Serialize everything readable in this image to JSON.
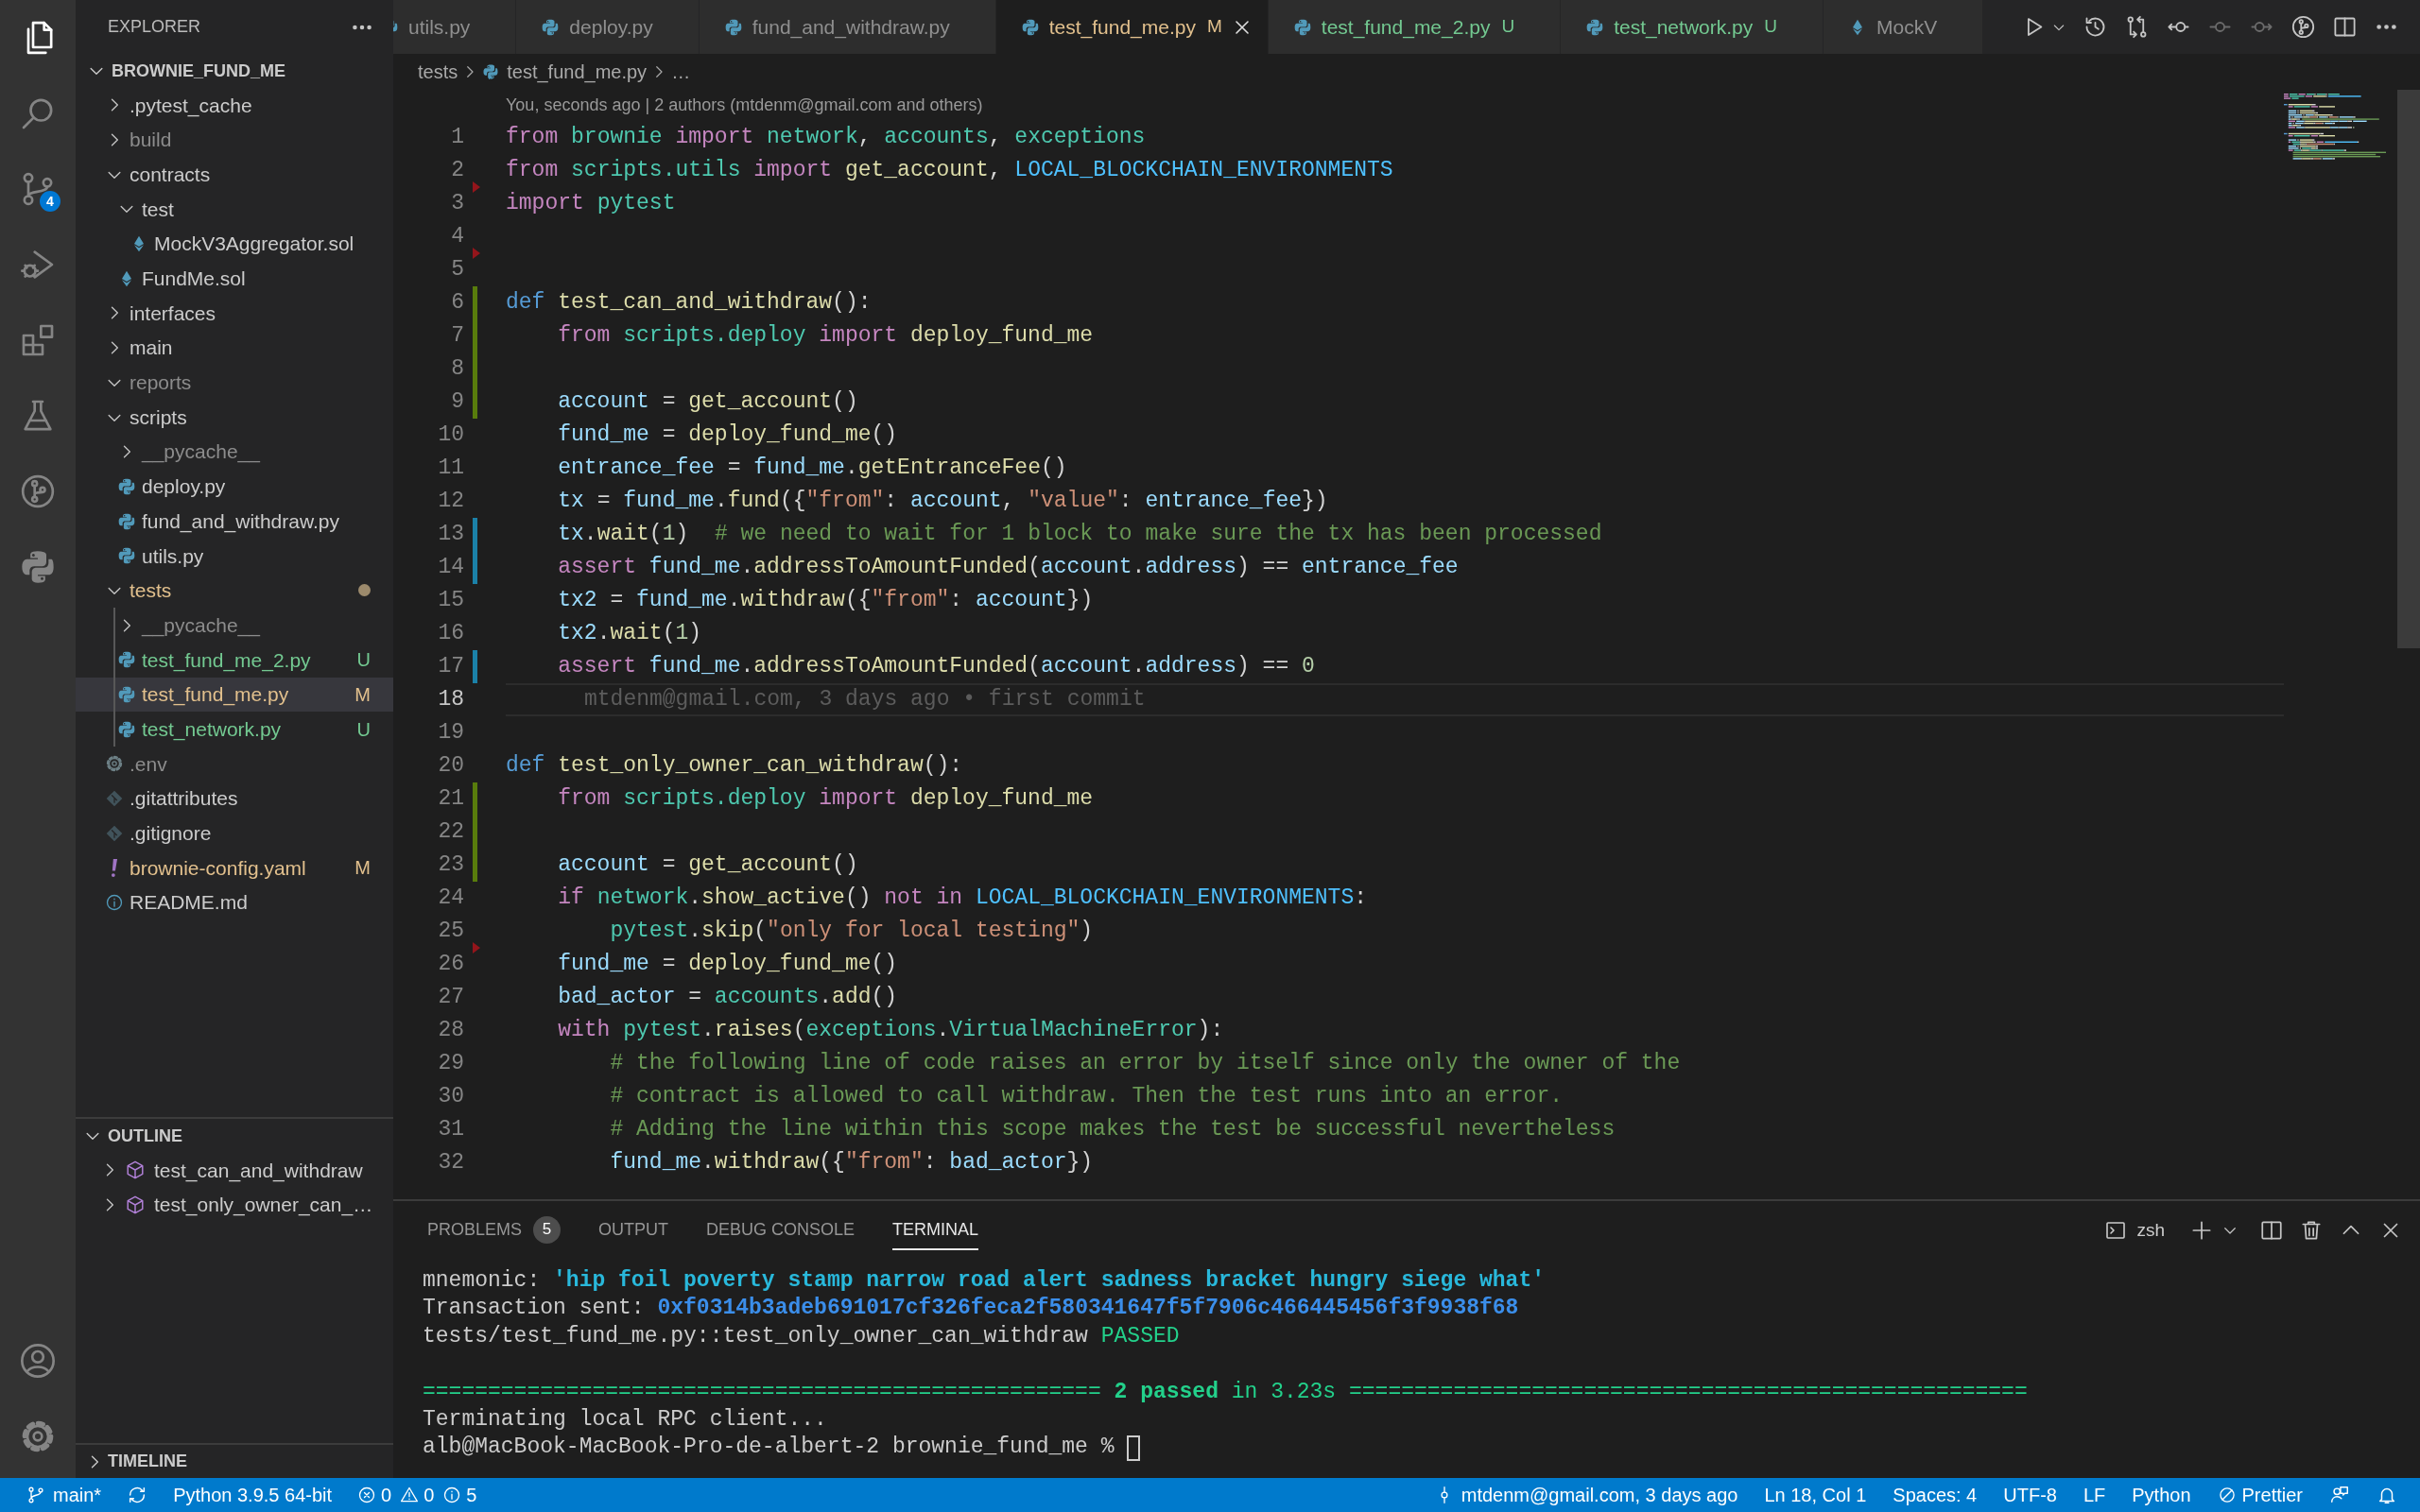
{
  "activity_bar": {
    "items": [
      {
        "kind": "files",
        "selected": true
      },
      {
        "kind": "search",
        "selected": false
      },
      {
        "kind": "source_control",
        "selected": false,
        "badge": "4"
      },
      {
        "kind": "run_debug",
        "selected": false
      },
      {
        "kind": "extensions",
        "selected": false
      },
      {
        "kind": "testing",
        "selected": false
      },
      {
        "kind": "git_graph",
        "selected": false
      },
      {
        "kind": "python",
        "selected": false
      }
    ],
    "bottom": [
      {
        "kind": "account"
      },
      {
        "kind": "settings"
      }
    ]
  },
  "sidebar": {
    "title": "EXPLORER",
    "folder": {
      "label": "BROWNIE_FUND_ME",
      "expanded": true,
      "items": [
        {
          "label": ".pytest_cache",
          "kind": "folder",
          "expanded": false,
          "dot": false,
          "color": "#cccccc",
          "selected": false
        },
        {
          "label": "build",
          "kind": "folder",
          "expanded": false,
          "dot": false,
          "color": "#8c8c8c",
          "selected": false
        },
        {
          "label": "contracts",
          "kind": "folder",
          "expanded": true,
          "dot": false,
          "color": "#cccccc",
          "selected": false,
          "children": [
            {
              "label": "test",
              "kind": "folder",
              "expanded": true,
              "dot": false,
              "color": "#cccccc",
              "selected": false,
              "children": [
                {
                  "label": "MockV3Aggregator.sol",
                  "kind": "solidity",
                  "color": "#cccccc",
                  "selected": false
                }
              ]
            },
            {
              "label": "FundMe.sol",
              "kind": "solidity",
              "color": "#cccccc",
              "selected": false
            }
          ]
        },
        {
          "label": "interfaces",
          "kind": "folder",
          "expanded": false,
          "dot": false,
          "color": "#cccccc",
          "selected": false
        },
        {
          "label": "main",
          "kind": "folder",
          "expanded": false,
          "dot": false,
          "color": "#cccccc",
          "selected": false
        },
        {
          "label": "reports",
          "kind": "folder",
          "expanded": true,
          "dot": false,
          "color": "#8c8c8c",
          "selected": false
        },
        {
          "label": "scripts",
          "kind": "folder",
          "expanded": true,
          "dot": false,
          "color": "#cccccc",
          "selected": false,
          "children": [
            {
              "label": "__pycache__",
              "kind": "folder",
              "expanded": false,
              "dot": false,
              "color": "#8c8c8c",
              "selected": false
            },
            {
              "label": "deploy.py",
              "kind": "python",
              "color": "#cccccc",
              "selected": false
            },
            {
              "label": "fund_and_withdraw.py",
              "kind": "python",
              "color": "#cccccc",
              "selected": false
            },
            {
              "label": "utils.py",
              "kind": "python",
              "color": "#cccccc",
              "selected": false
            }
          ]
        },
        {
          "label": "tests",
          "kind": "folder",
          "expanded": true,
          "dot": true,
          "color": "#e2c08d",
          "selected": false,
          "children": [
            {
              "label": "__pycache__",
              "kind": "folder",
              "expanded": false,
              "dot": false,
              "color": "#8c8c8c",
              "selected": false
            },
            {
              "label": "test_fund_me_2.py",
              "kind": "python",
              "color": "#73c991",
              "badge": "U",
              "selected": false
            },
            {
              "label": "test_fund_me.py",
              "kind": "python",
              "color": "#e2c08d",
              "badge": "M",
              "selected": true
            },
            {
              "label": "test_network.py",
              "kind": "python",
              "color": "#73c991",
              "badge": "U",
              "selected": false
            }
          ]
        },
        {
          "label": ".env",
          "kind": "config",
          "color": "#8c8c8c",
          "selected": false
        },
        {
          "label": ".gitattributes",
          "kind": "git",
          "color": "#cccccc",
          "selected": false
        },
        {
          "label": ".gitignore",
          "kind": "git",
          "color": "#cccccc",
          "selected": false
        },
        {
          "label": "brownie-config.yaml",
          "kind": "yaml",
          "color": "#e2c08d",
          "badge": "M",
          "selected": false
        },
        {
          "label": "README.md",
          "kind": "info",
          "color": "#cccccc",
          "selected": false
        }
      ]
    },
    "outline": {
      "title": "OUTLINE",
      "expanded": true,
      "items": [
        {
          "label": "test_can_and_withdraw",
          "expanded": false
        },
        {
          "label": "test_only_owner_can_…",
          "expanded": false
        }
      ]
    },
    "timeline": {
      "title": "TIMELINE",
      "expanded": false
    }
  },
  "editor": {
    "tabs": [
      {
        "label": "utils.py",
        "kind": "python",
        "color": "#8f8f8f",
        "selected": false
      },
      {
        "label": "deploy.py",
        "kind": "python",
        "color": "#8f8f8f",
        "selected": false
      },
      {
        "label": "fund_and_withdraw.py",
        "kind": "python",
        "color": "#8f8f8f",
        "selected": false
      },
      {
        "label": "test_fund_me.py",
        "kind": "python",
        "color": "#e2c08d",
        "badge": "M",
        "selected": true
      },
      {
        "label": "test_fund_me_2.py",
        "kind": "python",
        "color": "#73c991",
        "badge": "U",
        "selected": false
      },
      {
        "label": "test_network.py",
        "kind": "python",
        "color": "#73c991",
        "badge": "U",
        "selected": false
      },
      {
        "label": "MockV",
        "kind": "solidity",
        "color": "#8f8f8f",
        "selected": false
      }
    ],
    "actions": [
      {
        "kind": "run",
        "disabled": false
      },
      {
        "kind": "history",
        "disabled": false
      },
      {
        "kind": "compare",
        "disabled": false
      },
      {
        "kind": "previous_change",
        "disabled": false
      },
      {
        "kind": "current_change",
        "disabled": true
      },
      {
        "kind": "next_change",
        "disabled": true
      },
      {
        "kind": "git_graph",
        "disabled": false
      },
      {
        "kind": "split",
        "disabled": false
      },
      {
        "kind": "more",
        "disabled": false
      }
    ],
    "breadcrumbs": [
      {
        "label": "tests",
        "kind": "folder"
      },
      {
        "label": "test_fund_me.py",
        "kind": "python"
      },
      {
        "label": "…",
        "kind": "more"
      }
    ],
    "codelens": "You, seconds ago | 2 authors (mtdenm@gmail.com and others)",
    "lines": [
      {
        "n": "1",
        "kind": "plain",
        "current": false,
        "tokens": [
          {
            "kind": "kw",
            "text": "from"
          },
          {
            "kind": "cls",
            "text": " brownie"
          },
          {
            "kind": "kw",
            "text": " import"
          },
          {
            "kind": "cls",
            "text": " network"
          },
          {
            "kind": "p",
            "text": ", "
          },
          {
            "kind": "cls",
            "text": "accounts"
          },
          {
            "kind": "p",
            "text": ", "
          },
          {
            "kind": "cls",
            "text": "exceptions"
          }
        ]
      },
      {
        "n": "2",
        "kind": "plain",
        "current": false,
        "tokens": [
          {
            "kind": "kw",
            "text": "from"
          },
          {
            "kind": "cls",
            "text": " scripts.utils"
          },
          {
            "kind": "kw",
            "text": " import"
          },
          {
            "kind": "fn",
            "text": " get_account"
          },
          {
            "kind": "p",
            "text": ", "
          },
          {
            "kind": "const",
            "text": "LOCAL_BLOCKCHAIN_ENVIRONMENTS"
          }
        ]
      },
      {
        "n": "3",
        "kind": "deleted",
        "current": false,
        "tokens": [
          {
            "kind": "kw",
            "text": "import"
          },
          {
            "kind": "cls",
            "text": " pytest"
          }
        ]
      },
      {
        "n": "4",
        "kind": "plain",
        "current": false
      },
      {
        "n": "5",
        "kind": "deleted",
        "current": false
      },
      {
        "n": "6",
        "kind": "added",
        "current": false,
        "tokens": [
          {
            "kind": "def",
            "text": "def"
          },
          {
            "kind": "fn",
            "text": " test_can_and_withdraw"
          },
          {
            "kind": "p",
            "text": "():"
          }
        ]
      },
      {
        "n": "7",
        "kind": "added",
        "current": false,
        "tokens": [
          {
            "kind": "kw",
            "text": "    from"
          },
          {
            "kind": "cls",
            "text": " scripts.deploy"
          },
          {
            "kind": "kw",
            "text": " import"
          },
          {
            "kind": "fn",
            "text": " deploy_fund_me"
          }
        ]
      },
      {
        "n": "8",
        "kind": "added",
        "current": false
      },
      {
        "n": "9",
        "kind": "added",
        "current": false,
        "tokens": [
          {
            "kind": "var",
            "text": "    account"
          },
          {
            "kind": "p",
            "text": " = "
          },
          {
            "kind": "fn",
            "text": "get_account"
          },
          {
            "kind": "p",
            "text": "()"
          }
        ]
      },
      {
        "n": "10",
        "kind": "plain",
        "current": false,
        "tokens": [
          {
            "kind": "var",
            "text": "    fund_me"
          },
          {
            "kind": "p",
            "text": " = "
          },
          {
            "kind": "fn",
            "text": "deploy_fund_me"
          },
          {
            "kind": "p",
            "text": "()"
          }
        ]
      },
      {
        "n": "11",
        "kind": "plain",
        "current": false,
        "tokens": [
          {
            "kind": "var",
            "text": "    entrance_fee"
          },
          {
            "kind": "p",
            "text": " = "
          },
          {
            "kind": "var",
            "text": "fund_me"
          },
          {
            "kind": "p",
            "text": "."
          },
          {
            "kind": "fn",
            "text": "getEntranceFee"
          },
          {
            "kind": "p",
            "text": "()"
          }
        ]
      },
      {
        "n": "12",
        "kind": "plain",
        "current": false,
        "tokens": [
          {
            "kind": "var",
            "text": "    tx"
          },
          {
            "kind": "p",
            "text": " = "
          },
          {
            "kind": "var",
            "text": "fund_me"
          },
          {
            "kind": "p",
            "text": "."
          },
          {
            "kind": "fn",
            "text": "fund"
          },
          {
            "kind": "p",
            "text": "({"
          },
          {
            "kind": "str",
            "text": "\"from\""
          },
          {
            "kind": "p",
            "text": ": "
          },
          {
            "kind": "var",
            "text": "account"
          },
          {
            "kind": "p",
            "text": ", "
          },
          {
            "kind": "str",
            "text": "\"value\""
          },
          {
            "kind": "p",
            "text": ": "
          },
          {
            "kind": "var",
            "text": "entrance_fee"
          },
          {
            "kind": "p",
            "text": "})"
          }
        ]
      },
      {
        "n": "13",
        "kind": "modified",
        "current": false,
        "tokens": [
          {
            "kind": "var",
            "text": "    tx"
          },
          {
            "kind": "p",
            "text": "."
          },
          {
            "kind": "fn",
            "text": "wait"
          },
          {
            "kind": "p",
            "text": "("
          },
          {
            "kind": "num",
            "text": "1"
          },
          {
            "kind": "p",
            "text": ")  "
          },
          {
            "kind": "com",
            "text": "# we need to wait for 1 block to make sure the tx has been processed"
          }
        ]
      },
      {
        "n": "14",
        "kind": "modified",
        "current": false,
        "tokens": [
          {
            "kind": "kw",
            "text": "    assert"
          },
          {
            "kind": "var",
            "text": " fund_me"
          },
          {
            "kind": "p",
            "text": "."
          },
          {
            "kind": "fn",
            "text": "addressToAmountFunded"
          },
          {
            "kind": "p",
            "text": "("
          },
          {
            "kind": "var",
            "text": "account"
          },
          {
            "kind": "p",
            "text": "."
          },
          {
            "kind": "var",
            "text": "address"
          },
          {
            "kind": "p",
            "text": ") == "
          },
          {
            "kind": "var",
            "text": "entrance_fee"
          }
        ]
      },
      {
        "n": "15",
        "kind": "plain",
        "current": false,
        "tokens": [
          {
            "kind": "var",
            "text": "    tx2"
          },
          {
            "kind": "p",
            "text": " = "
          },
          {
            "kind": "var",
            "text": "fund_me"
          },
          {
            "kind": "p",
            "text": "."
          },
          {
            "kind": "fn",
            "text": "withdraw"
          },
          {
            "kind": "p",
            "text": "({"
          },
          {
            "kind": "str",
            "text": "\"from\""
          },
          {
            "kind": "p",
            "text": ": "
          },
          {
            "kind": "var",
            "text": "account"
          },
          {
            "kind": "p",
            "text": "})"
          }
        ]
      },
      {
        "n": "16",
        "kind": "plain",
        "current": false,
        "tokens": [
          {
            "kind": "var",
            "text": "    tx2"
          },
          {
            "kind": "p",
            "text": "."
          },
          {
            "kind": "fn",
            "text": "wait"
          },
          {
            "kind": "p",
            "text": "("
          },
          {
            "kind": "num",
            "text": "1"
          },
          {
            "kind": "p",
            "text": ")"
          }
        ]
      },
      {
        "n": "17",
        "kind": "modified",
        "current": false,
        "tokens": [
          {
            "kind": "kw",
            "text": "    assert"
          },
          {
            "kind": "var",
            "text": " fund_me"
          },
          {
            "kind": "p",
            "text": "."
          },
          {
            "kind": "fn",
            "text": "addressToAmountFunded"
          },
          {
            "kind": "p",
            "text": "("
          },
          {
            "kind": "var",
            "text": "account"
          },
          {
            "kind": "p",
            "text": "."
          },
          {
            "kind": "var",
            "text": "address"
          },
          {
            "kind": "p",
            "text": ") == "
          },
          {
            "kind": "num",
            "text": "0"
          }
        ]
      },
      {
        "n": "18",
        "kind": "plain",
        "current": true,
        "blame": "mtdenm@gmail.com, 3 days ago • first commit"
      },
      {
        "n": "19",
        "kind": "plain",
        "current": false
      },
      {
        "n": "20",
        "kind": "plain",
        "current": false,
        "tokens": [
          {
            "kind": "def",
            "text": "def"
          },
          {
            "kind": "fn",
            "text": " test_only_owner_can_withdraw"
          },
          {
            "kind": "p",
            "text": "():"
          }
        ]
      },
      {
        "n": "21",
        "kind": "added",
        "current": false,
        "tokens": [
          {
            "kind": "kw",
            "text": "    from"
          },
          {
            "kind": "cls",
            "text": " scripts.deploy"
          },
          {
            "kind": "kw",
            "text": " import"
          },
          {
            "kind": "fn",
            "text": " deploy_fund_me"
          }
        ]
      },
      {
        "n": "22",
        "kind": "added",
        "current": false
      },
      {
        "n": "23",
        "kind": "added",
        "current": false,
        "tokens": [
          {
            "kind": "var",
            "text": "    account"
          },
          {
            "kind": "p",
            "text": " = "
          },
          {
            "kind": "fn",
            "text": "get_account"
          },
          {
            "kind": "p",
            "text": "()"
          }
        ]
      },
      {
        "n": "24",
        "kind": "plain",
        "current": false,
        "tokens": [
          {
            "kind": "kw",
            "text": "    if"
          },
          {
            "kind": "cls",
            "text": " network"
          },
          {
            "kind": "p",
            "text": "."
          },
          {
            "kind": "fn",
            "text": "show_active"
          },
          {
            "kind": "p",
            "text": "() "
          },
          {
            "kind": "kw",
            "text": "not in"
          },
          {
            "kind": "const",
            "text": " LOCAL_BLOCKCHAIN_ENVIRONMENTS"
          },
          {
            "kind": "p",
            "text": ":"
          }
        ]
      },
      {
        "n": "25",
        "kind": "plain",
        "current": false,
        "tokens": [
          {
            "kind": "cls",
            "text": "        pytest"
          },
          {
            "kind": "p",
            "text": "."
          },
          {
            "kind": "fn",
            "text": "skip"
          },
          {
            "kind": "p",
            "text": "("
          },
          {
            "kind": "str",
            "text": "\"only for local testing\""
          },
          {
            "kind": "p",
            "text": ")"
          }
        ]
      },
      {
        "n": "26",
        "kind": "deleted",
        "current": false,
        "tokens": [
          {
            "kind": "var",
            "text": "    fund_me"
          },
          {
            "kind": "p",
            "text": " = "
          },
          {
            "kind": "fn",
            "text": "deploy_fund_me"
          },
          {
            "kind": "p",
            "text": "()"
          }
        ]
      },
      {
        "n": "27",
        "kind": "plain",
        "current": false,
        "tokens": [
          {
            "kind": "var",
            "text": "    bad_actor"
          },
          {
            "kind": "p",
            "text": " = "
          },
          {
            "kind": "cls",
            "text": "accounts"
          },
          {
            "kind": "p",
            "text": "."
          },
          {
            "kind": "fn",
            "text": "add"
          },
          {
            "kind": "p",
            "text": "()"
          }
        ]
      },
      {
        "n": "28",
        "kind": "plain",
        "current": false,
        "tokens": [
          {
            "kind": "kw",
            "text": "    with"
          },
          {
            "kind": "cls",
            "text": " pytest"
          },
          {
            "kind": "p",
            "text": "."
          },
          {
            "kind": "fn",
            "text": "raises"
          },
          {
            "kind": "p",
            "text": "("
          },
          {
            "kind": "cls",
            "text": "exceptions"
          },
          {
            "kind": "p",
            "text": "."
          },
          {
            "kind": "cls",
            "text": "VirtualMachineError"
          },
          {
            "kind": "p",
            "text": "):"
          }
        ]
      },
      {
        "n": "29",
        "kind": "plain",
        "current": false,
        "tokens": [
          {
            "kind": "com",
            "text": "        # the following line of code raises an error by itself since only the owner of the"
          }
        ]
      },
      {
        "n": "30",
        "kind": "plain",
        "current": false,
        "tokens": [
          {
            "kind": "com",
            "text": "        # contract is allowed to call withdraw. Then the test runs into an error."
          }
        ]
      },
      {
        "n": "31",
        "kind": "plain",
        "current": false,
        "tokens": [
          {
            "kind": "com",
            "text": "        # Adding the line within this scope makes the test be successful nevertheless"
          }
        ]
      },
      {
        "n": "32",
        "kind": "plain",
        "current": false,
        "tokens": [
          {
            "kind": "var",
            "text": "        fund_me"
          },
          {
            "kind": "p",
            "text": "."
          },
          {
            "kind": "fn",
            "text": "withdraw"
          },
          {
            "kind": "p",
            "text": "({"
          },
          {
            "kind": "str",
            "text": "\"from\""
          },
          {
            "kind": "p",
            "text": ": "
          },
          {
            "kind": "var",
            "text": "bad_actor"
          },
          {
            "kind": "p",
            "text": "})"
          }
        ]
      }
    ]
  },
  "panel": {
    "tabs": [
      {
        "label": "PROBLEMS",
        "badge": "5",
        "selected": false
      },
      {
        "label": "OUTPUT",
        "selected": false
      },
      {
        "label": "DEBUG CONSOLE",
        "selected": false
      },
      {
        "label": "TERMINAL",
        "selected": true
      }
    ],
    "shell": "zsh",
    "terminal": [
      {
        "kind": "text",
        "segments": [
          {
            "kind": "p",
            "text": "mnemonic: "
          },
          {
            "kind": "cyan",
            "text": "'hip foil poverty stamp narrow road alert sadness bracket hungry siege what'"
          }
        ]
      },
      {
        "kind": "text",
        "segments": [
          {
            "kind": "p",
            "text": "Transaction sent: "
          },
          {
            "kind": "blue",
            "text": "0xf0314b3adeb691017cf326feca2f580341647f5f7906c466445456f3f9938f68"
          }
        ]
      },
      {
        "kind": "text",
        "segments": [
          {
            "kind": "p",
            "text": "tests/test_fund_me.py::test_only_owner_can_withdraw "
          },
          {
            "kind": "green",
            "text": "PASSED"
          }
        ]
      },
      {
        "kind": "blank"
      },
      {
        "kind": "text",
        "segments": [
          {
            "kind": "green",
            "text": "==================================================== "
          },
          {
            "kind": "greenb",
            "text": "2 passed"
          },
          {
            "kind": "green",
            "text": " in 3.23s ===================================================="
          }
        ]
      },
      {
        "kind": "text",
        "segments": [
          {
            "kind": "p",
            "text": "Terminating local RPC client..."
          }
        ]
      },
      {
        "kind": "prompt",
        "segments": [
          {
            "kind": "p",
            "text": "alb@MacBook-MacBook-Pro-de-albert-2 brownie_fund_me % "
          }
        ]
      }
    ]
  },
  "status_bar": {
    "left": [
      {
        "kind": "branch",
        "text": "main*"
      },
      {
        "kind": "sync"
      },
      {
        "kind": "text",
        "text": "Python 3.9.5 64-bit"
      },
      {
        "kind": "problems",
        "errors": "0",
        "warnings": "0",
        "infos": "5"
      }
    ],
    "right": [
      {
        "kind": "blame",
        "text": "mtdenm@gmail.com, 3 days ago"
      },
      {
        "kind": "text",
        "text": "Ln 18, Col 1"
      },
      {
        "kind": "text",
        "text": "Spaces: 4"
      },
      {
        "kind": "text",
        "text": "UTF-8"
      },
      {
        "kind": "text",
        "text": "LF"
      },
      {
        "kind": "text",
        "text": "Python"
      },
      {
        "kind": "prettier",
        "text": "Prettier"
      },
      {
        "kind": "feedback"
      },
      {
        "kind": "notifications"
      }
    ]
  }
}
